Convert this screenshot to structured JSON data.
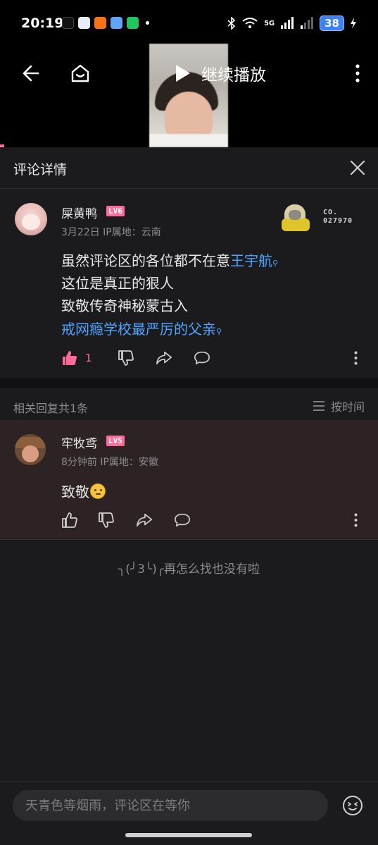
{
  "status_bar": {
    "time": "20:19",
    "network": "5G",
    "battery": "38",
    "app_icon_colors": [
      "#000000",
      "#3b82f6",
      "#f97316",
      "#60a5fa",
      "#22c55e"
    ]
  },
  "video": {
    "resume_label": "继续播放"
  },
  "panel": {
    "title": "评论详情"
  },
  "main_comment": {
    "username": "屎黄鸭",
    "level": "LV6",
    "level_color": "#ff6b98",
    "meta": "3月22日 IP属地：云南",
    "fan_badge_number_line1": "CO.",
    "fan_badge_number_line2": "027970",
    "lines": {
      "line1_text": "虽然评论区的各位都不在意",
      "line1_link": "王宇航",
      "line2": "这位是真正的狠人",
      "line3": "致敬传奇神秘蒙古入",
      "line4_link": "戒网瘾学校最严厉的父亲"
    },
    "like_count": "1"
  },
  "replies": {
    "count_label": "相关回复共1条",
    "sort_label": "按时间"
  },
  "reply": {
    "username": "牢牧鸢",
    "level": "LV5",
    "level_color": "#ff6b98",
    "meta": "8分钟前 IP属地：安徽",
    "content": "致敬"
  },
  "end_text": "╮(╯3╰)╭再怎么找也没有啦",
  "input": {
    "placeholder": "天青色等烟雨，评论区在等你"
  },
  "colors": {
    "accent_pink": "#fb7299",
    "link_blue": "#4fa3ff",
    "reply_highlight_bg": "#2d2224"
  }
}
